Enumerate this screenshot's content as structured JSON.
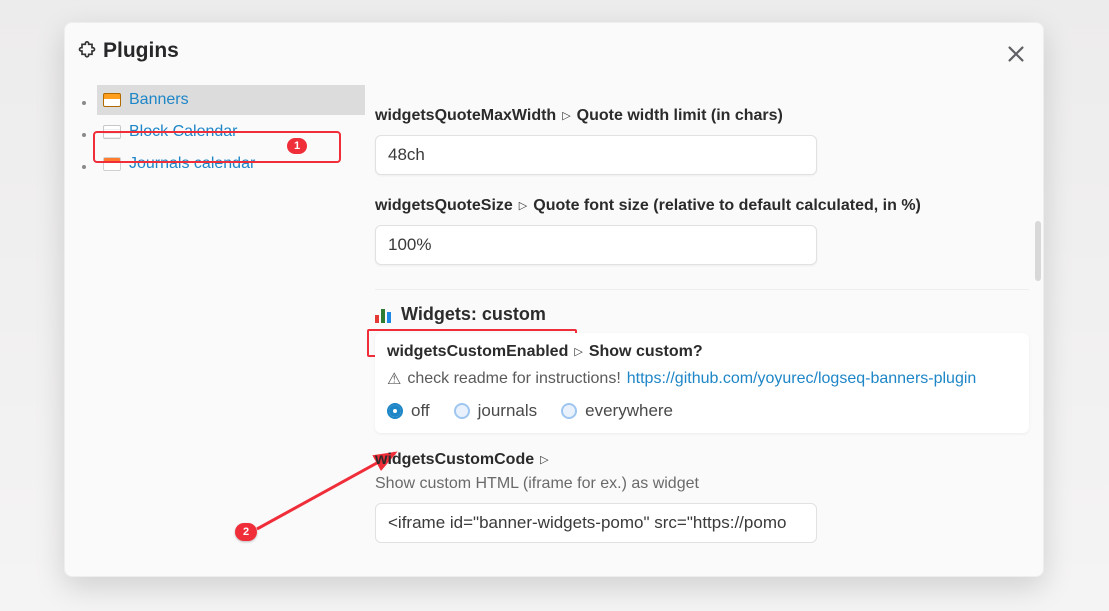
{
  "header": {
    "title": "Plugins"
  },
  "callouts": {
    "one": "1",
    "two": "2"
  },
  "sidebar": {
    "items": [
      {
        "label": "Banners",
        "icon": "banner-icon",
        "selected": true
      },
      {
        "label": "Block Calendar",
        "icon": "block-icon",
        "selected": false
      },
      {
        "label": "Journals calendar",
        "icon": "journal-icon",
        "selected": false
      }
    ]
  },
  "content": {
    "quoteMaxWidth": {
      "key": "widgetsQuoteMaxWidth",
      "desc": "Quote width limit (in chars)",
      "value": "48ch"
    },
    "quoteSize": {
      "key": "widgetsQuoteSize",
      "desc": "Quote font size (relative to default calculated, in %)",
      "value": "100%"
    },
    "section": {
      "title": "Widgets: custom",
      "customEnabled": {
        "key": "widgetsCustomEnabled",
        "desc": "Show custom?",
        "note_prefix": "check readme for instructions!",
        "note_link": "https://github.com/yoyurec/logseq-banners-plugin",
        "options": {
          "off": "off",
          "journals": "journals",
          "everywhere": "everywhere"
        },
        "selected": "off"
      },
      "customCode": {
        "key": "widgetsCustomCode",
        "desc": "Show custom HTML (iframe for ex.) as widget",
        "value": "<iframe id=\"banner-widgets-pomo\" src=\"https://pomo"
      }
    }
  }
}
